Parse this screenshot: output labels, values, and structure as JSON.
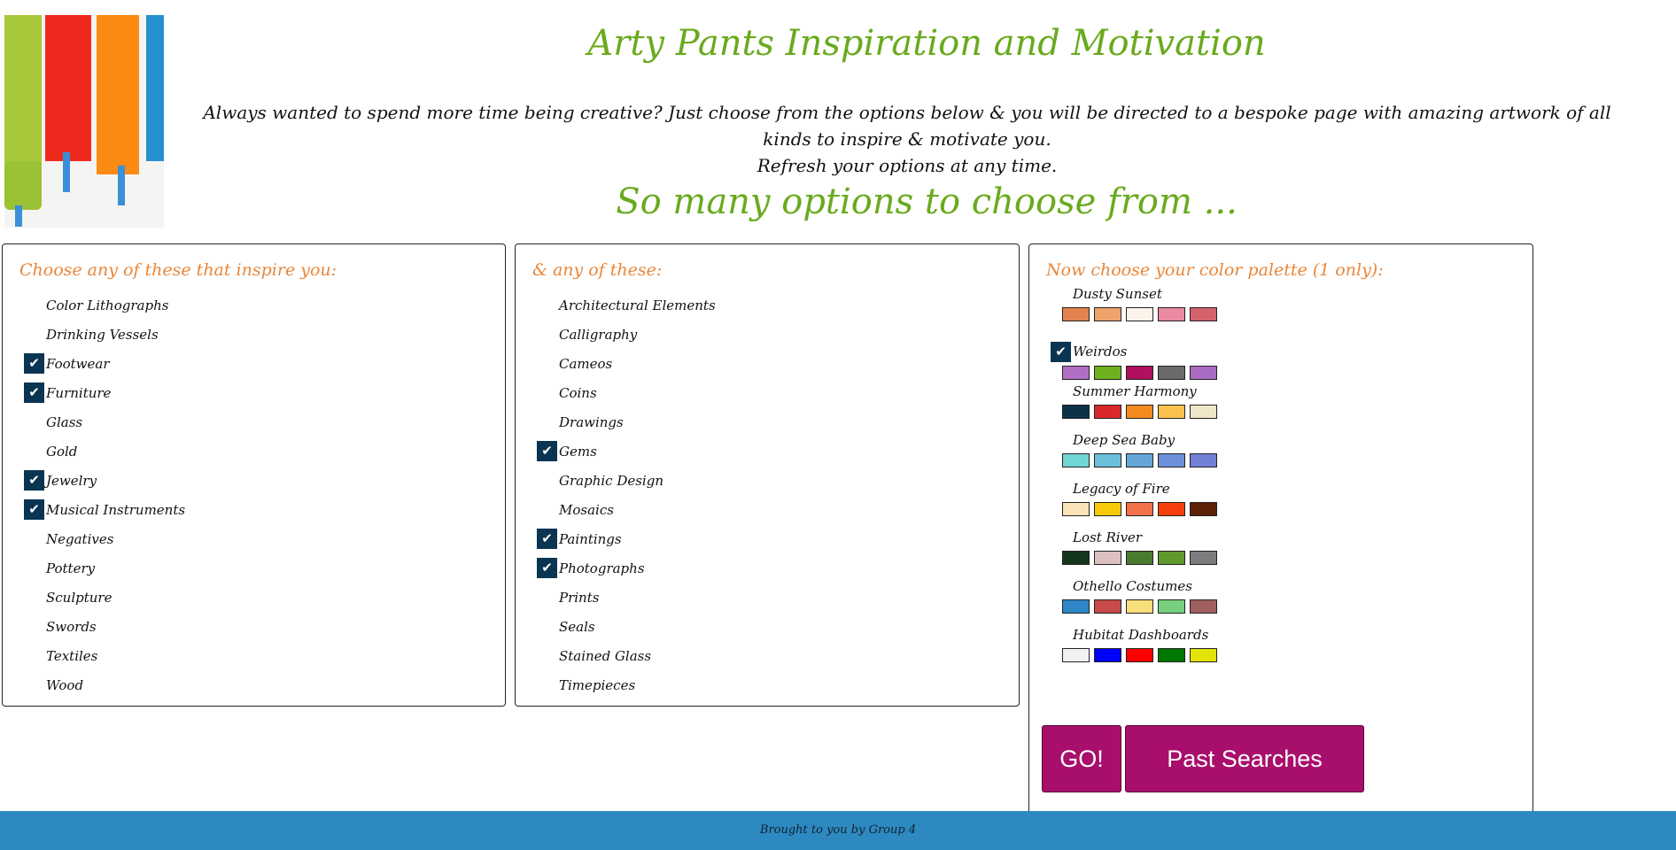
{
  "header": {
    "title": "Arty Pants Inspiration and Motivation",
    "intro_line1": "Always wanted to spend more time being creative? Just choose from the options below & you will be directed to a bespoke page with amazing artwork of all kinds to inspire & motivate you.",
    "intro_line2": "Refresh your options at any time.",
    "subtitle": "So many options to choose from ..."
  },
  "colors": {
    "green_accent": "#6aaa1e",
    "orange_heading": "#e8863a",
    "check_bg": "#0a3552",
    "button_bg": "#a80e6c",
    "footer_bg": "#2e89c0"
  },
  "panel1": {
    "heading": "Choose any of these that inspire you:",
    "options": [
      {
        "label": "Color Lithographs",
        "checked": false
      },
      {
        "label": "Drinking Vessels",
        "checked": false
      },
      {
        "label": "Footwear",
        "checked": true
      },
      {
        "label": "Furniture",
        "checked": true
      },
      {
        "label": "Glass",
        "checked": false
      },
      {
        "label": "Gold",
        "checked": false
      },
      {
        "label": "Jewelry",
        "checked": true
      },
      {
        "label": "Musical Instruments",
        "checked": true
      },
      {
        "label": "Negatives",
        "checked": false
      },
      {
        "label": "Pottery",
        "checked": false
      },
      {
        "label": "Sculpture",
        "checked": false
      },
      {
        "label": "Swords",
        "checked": false
      },
      {
        "label": "Textiles",
        "checked": false
      },
      {
        "label": "Wood",
        "checked": false
      }
    ]
  },
  "panel2": {
    "heading": "& any of these:",
    "options": [
      {
        "label": "Architectural Elements",
        "checked": false
      },
      {
        "label": "Calligraphy",
        "checked": false
      },
      {
        "label": "Cameos",
        "checked": false
      },
      {
        "label": "Coins",
        "checked": false
      },
      {
        "label": "Drawings",
        "checked": false
      },
      {
        "label": "Gems",
        "checked": true
      },
      {
        "label": "Graphic Design",
        "checked": false
      },
      {
        "label": "Mosaics",
        "checked": false
      },
      {
        "label": "Paintings",
        "checked": true
      },
      {
        "label": "Photographs",
        "checked": true
      },
      {
        "label": "Prints",
        "checked": false
      },
      {
        "label": "Seals",
        "checked": false
      },
      {
        "label": "Stained Glass",
        "checked": false
      },
      {
        "label": "Timepieces",
        "checked": false
      }
    ]
  },
  "panel3": {
    "heading": "Now choose your color palette (1 only):",
    "palettes": [
      {
        "name": "Dusty Sunset",
        "selected": false,
        "colors": [
          "#e5834e",
          "#eea36b",
          "#fdf3ea",
          "#e98aa0",
          "#d5636e"
        ]
      },
      {
        "name": "Weirdos",
        "selected": true,
        "colors": [
          "#b06fc4",
          "#6fb01e",
          "#b0105e",
          "#6b6b6b",
          "#a96bc2"
        ]
      },
      {
        "name": "Summer Harmony",
        "selected": false,
        "colors": [
          "#0b3249",
          "#d9282b",
          "#f58a1f",
          "#fbc04d",
          "#eee6c8"
        ]
      },
      {
        "name": "Deep Sea Baby",
        "selected": false,
        "colors": [
          "#72d5d5",
          "#6ac0d8",
          "#64a6d8",
          "#6b8fd8",
          "#7280d6"
        ]
      },
      {
        "name": "Legacy of Fire",
        "selected": false,
        "colors": [
          "#fbe3b8",
          "#f8c90a",
          "#f2724a",
          "#f73f0d",
          "#5d2208"
        ]
      },
      {
        "name": "Lost River",
        "selected": false,
        "colors": [
          "#15361c",
          "#dcc0c2",
          "#4a7a30",
          "#609a2c",
          "#7d7d7d"
        ]
      },
      {
        "name": "Othello Costumes",
        "selected": false,
        "colors": [
          "#2e86c8",
          "#c84a4a",
          "#f8df7c",
          "#77d07e",
          "#a06060"
        ]
      },
      {
        "name": "Hubitat Dashboards",
        "selected": false,
        "colors": [
          "#f2f2f2",
          "#0000ff",
          "#ff0000",
          "#007700",
          "#e3e30a"
        ]
      }
    ],
    "go_label": "GO!",
    "past_label": "Past Searches"
  },
  "footer": {
    "text": "Brought to you by Group 4"
  }
}
